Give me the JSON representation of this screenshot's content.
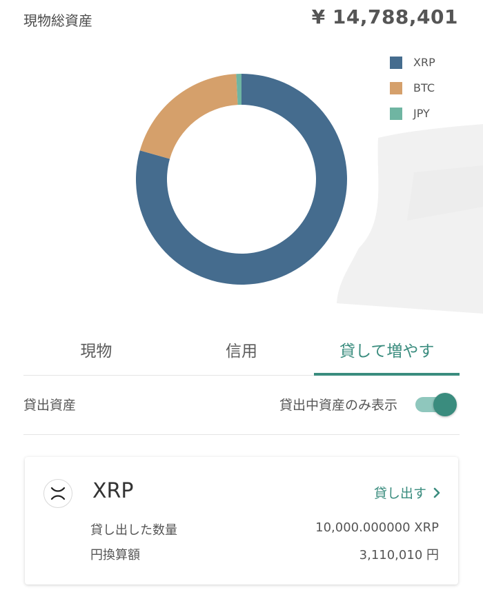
{
  "header": {
    "title": "現物総資産",
    "total": "¥ 14,788,401"
  },
  "chart_data": {
    "type": "pie",
    "categories": [
      "XRP",
      "BTC",
      "JPY"
    ],
    "values": [
      79.4,
      19.8,
      0.8
    ],
    "colors": [
      "#456c8e",
      "#d5a06b",
      "#6fb5a2"
    ],
    "legend_position": "top-right",
    "title": ""
  },
  "tabs": [
    {
      "label": "現物",
      "active": false
    },
    {
      "label": "信用",
      "active": false
    },
    {
      "label": "貸して増やす",
      "active": true
    }
  ],
  "filter": {
    "label": "貸出資産",
    "toggle_label": "貸出中資産のみ表示",
    "toggle_on": true
  },
  "card": {
    "coin": "XRP",
    "icon": "xrp-icon",
    "lend_label": "貸し出す",
    "rows": [
      {
        "label": "貸し出した数量",
        "value": "10,000.000000 XRP"
      },
      {
        "label": "円換算額",
        "value": "3,110,010 円"
      }
    ]
  },
  "colors": {
    "accent": "#3a8c7e",
    "toggle_track": "#8fc7bd"
  }
}
